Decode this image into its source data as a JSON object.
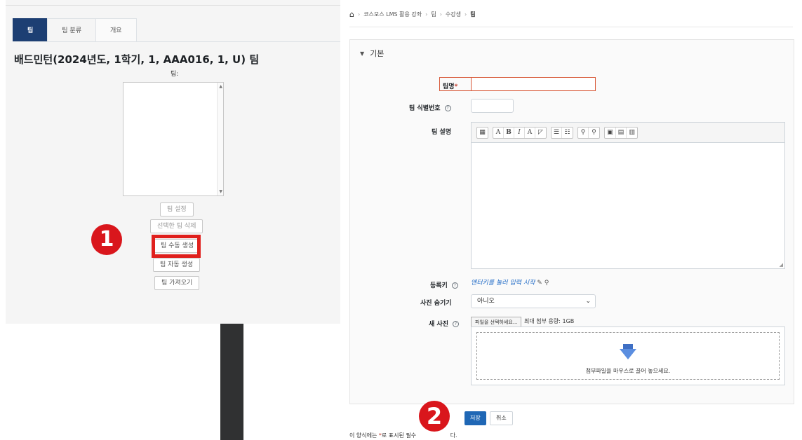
{
  "left": {
    "tabs": [
      {
        "label": "팀"
      },
      {
        "label": "팀 분류"
      },
      {
        "label": "개요"
      }
    ],
    "title": "배드민턴(2024년도, 1학기, 1, AAA016, 1, U) 팀",
    "teams_label": "팀:",
    "buttons": {
      "team_settings": "팀 설정",
      "delete_selected": "선택한 팀 삭제",
      "create_manual": "팀 수동 생성",
      "create_auto": "팀 자동 생성",
      "import": "팀 가져오기"
    },
    "step_badge": "1"
  },
  "right": {
    "breadcrumb": [
      "코스모스 LMS 활용 강좌",
      "팀",
      "수강생",
      "팀"
    ],
    "section_title": "기본",
    "fields": {
      "name_label": "팀명",
      "idnumber_label": "팀 식별번호",
      "description_label": "팀 설명",
      "enrolkey_label": "등록키",
      "enrolkey_link": "엔터키를 눌러 입력 시작",
      "hide_picture_label": "사진 숨기기",
      "hide_picture_value": "아니오",
      "new_picture_label": "새 사진",
      "file_button": "파일을 선택하세요...",
      "max_size": "최대 첨부 용량: 1GB",
      "drop_text": "첨부파일을 마우스로 끌어 놓으세요."
    },
    "toolbar": [
      "▦",
      "A",
      "B",
      "I",
      "A",
      "◸",
      "☰",
      "☷",
      "⚲",
      "⚲",
      "▣",
      "▤",
      "▥"
    ],
    "buttons": {
      "save": "저장",
      "cancel": "취소"
    },
    "required_note_prefix": "이 양식에는 ",
    "required_note_star": "*",
    "required_note_suffix": "로 표시된 필수 ",
    "required_note_end": "다.",
    "step_badge": "2"
  },
  "colors": {
    "accent_dark_blue": "#1d3f73",
    "primary_blue": "#1f67b5",
    "highlight_red": "#e0201d",
    "badge_red": "#d9161c",
    "name_field_border": "#d85a3a"
  }
}
